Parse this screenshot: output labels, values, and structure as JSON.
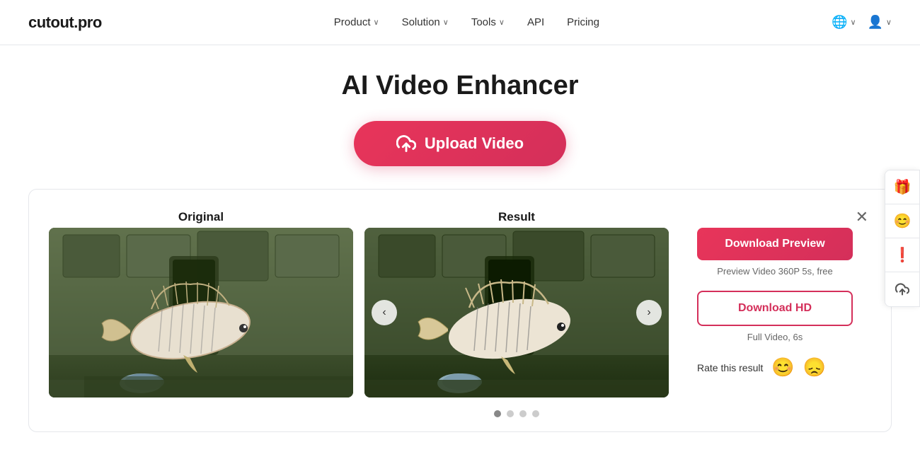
{
  "brand": {
    "name": "cutout.pro"
  },
  "nav": {
    "links": [
      {
        "label": "Product",
        "hasDropdown": true
      },
      {
        "label": "Solution",
        "hasDropdown": true
      },
      {
        "label": "Tools",
        "hasDropdown": true
      },
      {
        "label": "API",
        "hasDropdown": false
      },
      {
        "label": "Pricing",
        "hasDropdown": false
      }
    ],
    "translate_icon": "🌐",
    "user_icon": "👤"
  },
  "hero": {
    "title": "AI Video Enhancer",
    "upload_btn_label": "Upload Video"
  },
  "card": {
    "original_label": "Original",
    "result_label": "Result",
    "close_icon": "✕",
    "prev_arrow": "‹",
    "next_arrow": "›",
    "dots": [
      {
        "active": true
      },
      {
        "active": false
      },
      {
        "active": false
      },
      {
        "active": false
      }
    ]
  },
  "download": {
    "preview_btn": "Download Preview",
    "preview_info": "Preview Video 360P 5s, free",
    "hd_btn": "Download HD",
    "hd_info": "Full Video, 6s",
    "rate_label": "Rate this result",
    "happy_emoji": "😊",
    "sad_emoji": "😞"
  },
  "side_float": {
    "gift_icon": "🎁",
    "face_icon": "😊",
    "alert_icon": "❗",
    "upload_icon": "⬆"
  },
  "colors": {
    "brand_pink": "#d42f5a",
    "text_dark": "#1a1a1a"
  }
}
